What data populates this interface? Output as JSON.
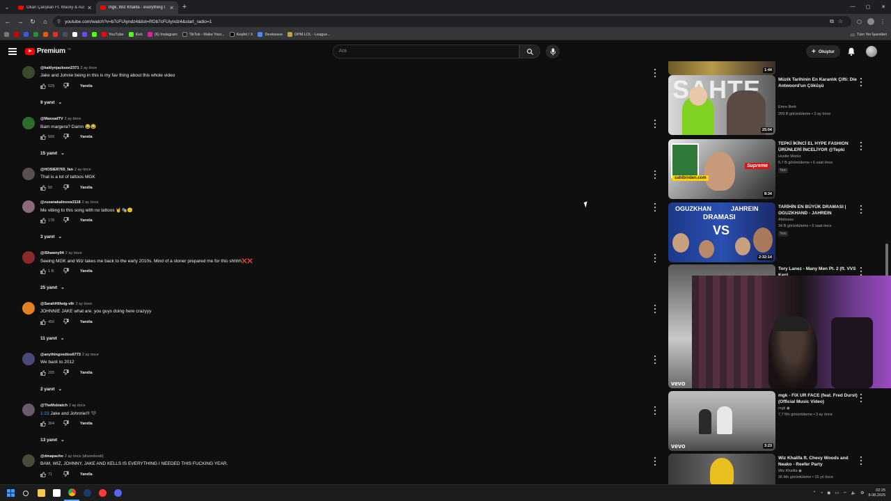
{
  "browser": {
    "tabs": [
      {
        "title": "Okan Çalışkan Ft. Wacky & Aus",
        "active": false
      },
      {
        "title": "mgk, Wiz Khalifa - everything I",
        "active": true
      }
    ],
    "new_tab": "+",
    "window_controls": [
      "—",
      "▢",
      "✕"
    ],
    "url": "youtube.com/watch?v=b7cFUIyndz4&list=RDb7cFUIyndz4&start_radio=1",
    "bookmarks": [
      {
        "label": "YouTube",
        "color": "#ff0000"
      },
      {
        "label": "Kick",
        "color": "#53fc18"
      },
      {
        "label": "(6) Instagram",
        "color": "#d6249f"
      },
      {
        "label": "TikTok - Make Your...",
        "color": "#ffffff"
      },
      {
        "label": "Keşfet / X",
        "color": "#ffffff"
      },
      {
        "label": "Deokwave",
        "color": "#4a90e2"
      },
      {
        "label": "DPM.LOL - League...",
        "color": "#c89b3c"
      }
    ],
    "bookmarks_right": "Tüm Yer İşaretleri"
  },
  "youtube": {
    "logo_text": "Premium",
    "logo_tm": "TR",
    "search_placeholder": "Ara",
    "create_label": "Oluştur"
  },
  "comments": [
    {
      "handle": "@kaitlynjackson2371",
      "time": "2 ay önce",
      "text": "Jake and Johnie being in this is my fav thing about this whole video",
      "likes": "629",
      "reply": "Yanıtla",
      "replies": "9 yanıt",
      "avatar": "#3b4a2e"
    },
    {
      "handle": "@MaxxadTV",
      "time": "2 ay önce",
      "text": "Bam margera? Damn 😂😂",
      "likes": "500",
      "reply": "Yanıtla",
      "replies": "15 yanıt",
      "avatar": "#2e6b2e"
    },
    {
      "handle": "@HOSIER765_fan",
      "time": "2 ay önce",
      "text": "That is a lot of tattoos MGK",
      "likes": "50",
      "reply": "Yanıtla",
      "replies": "",
      "avatar": "#5a5050"
    },
    {
      "handle": "@zuzanakalinova3118",
      "time": "2 ay önce",
      "text": "Me vibing to this song with no tattoos 🤘🎭🙃",
      "likes": "178",
      "reply": "Yanıtla",
      "replies": "3 yanıt",
      "avatar": "#8a6a7a"
    },
    {
      "handle": "@iShawny94",
      "time": "2 ay önce",
      "text": "Seeing MGK and Wiz takes me back to the early 2010s. Mind of a stoner prepared me for this shhhh❌❌",
      "likes": "1 B",
      "reply": "Yanıtla",
      "replies": "25 yanıt",
      "avatar": "#8a2a2a"
    },
    {
      "handle": "@SarahHillwig-v9r",
      "time": "2 ay önce",
      "text": "JOHNNIE JAKE what are. you guys doing here crazyyy",
      "likes": "456",
      "reply": "Yanıtla",
      "replies": "11 yanıt",
      "avatar": "#e67e22"
    },
    {
      "handle": "@anythingvedios6773",
      "time": "2 ay önce",
      "text": "We back to 2012",
      "likes": "205",
      "reply": "Yanıtla",
      "replies": "2 yanıt",
      "avatar": "#4a4a7a"
    },
    {
      "handle": "@TheMsbiatch",
      "time": "2 ay önce",
      "text": "Jake and Johnnie!!! 🖤",
      "timestamp": "1:23",
      "likes": "304",
      "reply": "Yanıtla",
      "replies": "13 yanıt",
      "avatar": "#6a5a6a"
    },
    {
      "handle": "@dmapacho",
      "time": "2 ay önce (düzenlendi)",
      "text": "BAM, WIZ, JOHNNY, JAKE AND KELLS IS EVERYTHING I NEEDED THIS FUCKING YEAR.",
      "likes": "71",
      "reply": "Yanıtla",
      "replies": "",
      "avatar": "#4a4a3a"
    }
  ],
  "sidebar_videos": [
    {
      "title": "",
      "channel": "",
      "meta": "",
      "duration": "1:44",
      "badge": ""
    },
    {
      "title": "Müzik Tarihinin En Karanlık Çifti: Die Antwoord'un Çöküşü",
      "channel": "Emre Berk",
      "meta": "209 B görüntüleme • 2 ay önce",
      "duration": "25:04",
      "badge": ""
    },
    {
      "title": "TEPKİ İKİNCİ EL HYPE FASHION ÜRÜNLERİ İNCELİYOR @Tepki",
      "channel": "Hustle Works",
      "meta": "6,7 B görüntüleme • 6 saat önce",
      "duration": "8:34",
      "badge": "Yeni"
    },
    {
      "title": "TARİHİN EN BÜYÜK DRAMASI | OGUZKHAND - JAHREIN",
      "channel": "Afeliosss",
      "meta": "34 B görüntüleme • 6 saat önce",
      "duration": "2:32:14",
      "badge": "Yeni"
    },
    {
      "title": "Tory Lanez - Many Men Pt. 2 (ft. VVS Ken)",
      "channel": "",
      "meta": "",
      "duration": "",
      "badge": ""
    },
    {
      "title": "mgk - FIX UR FACE (feat. Fred Durst) (Official Music Video)",
      "channel": "mgk ◉",
      "meta": "7,7 Mn görüntüleme • 3 ay önce",
      "duration": "3:23",
      "badge": ""
    },
    {
      "title": "Wiz Khalifa ft. Chevy Woods and Neako - Reefer Party",
      "channel": "Wiz Khalifa ◉",
      "meta": "36 Mn görüntüleme • 15 yıl önce",
      "duration": "",
      "badge": ""
    }
  ],
  "thumb_text": {
    "sahte": "SAHTE",
    "supreme": "Supreme",
    "sahibinden": "sahibinden.com",
    "oguzkhan": "OGUZKHAN",
    "jahrein": "JAHREIN",
    "dramasi": "DRAMASI",
    "vs": "VS",
    "vevo": "vevo"
  },
  "taskbar": {
    "time": "02:25",
    "date": "8.08.2025"
  }
}
